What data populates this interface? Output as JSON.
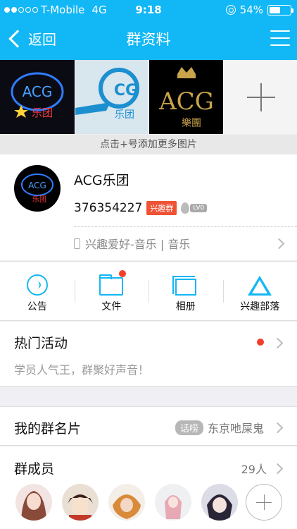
{
  "status": {
    "carrier": "T-Mobile",
    "network": "4G",
    "time": "9:18",
    "battery": "54%",
    "battery_level": 0.54
  },
  "nav": {
    "back_label": "返回",
    "title": "群资料"
  },
  "photos": {
    "items": [
      {
        "text": "ACG",
        "subtext": "乐团"
      },
      {
        "text": "CG",
        "subtext": "乐团"
      },
      {
        "text": "ACG",
        "subtext": "樂團"
      }
    ],
    "hint": "点击+号添加更多图片"
  },
  "group": {
    "avatar_text": "ACG",
    "avatar_subtext": "乐团",
    "name": "ACG乐团",
    "id": "376354227",
    "type_tag": "兴趣群",
    "level": "LV0",
    "category": "兴趣爱好-音乐 | 音乐"
  },
  "actions": [
    {
      "label": "公告"
    },
    {
      "label": "文件"
    },
    {
      "label": "相册"
    },
    {
      "label": "兴趣部落"
    }
  ],
  "hot": {
    "title": "热门活动",
    "subtitle": "学员人气王，群聚好声音！"
  },
  "card": {
    "title": "我的群名片",
    "badge": "话唠",
    "name": "东京吔屎鬼"
  },
  "members": {
    "title": "群成员",
    "count": "29人"
  },
  "colors": {
    "accent": "#12b7f5",
    "alert": "#f43e2c",
    "tag": "#ee5335"
  }
}
